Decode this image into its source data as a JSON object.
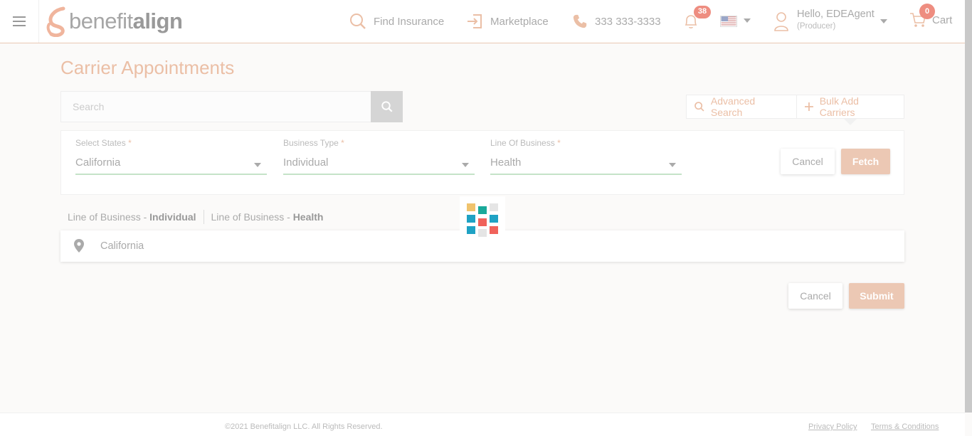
{
  "header": {
    "logo": {
      "part1": "benefit",
      "part2": "align"
    },
    "nav": {
      "find_insurance": "Find Insurance",
      "marketplace": "Marketplace",
      "phone": "333 333-3333"
    },
    "notifications_count": "38",
    "user": {
      "greeting": "Hello, EDEAgent",
      "role": "(Producer)"
    },
    "cart": {
      "label": "Cart",
      "count": "0"
    }
  },
  "page": {
    "title": "Carrier Appointments",
    "search": {
      "placeholder": "Search",
      "value": ""
    },
    "advanced_search": "Advanced Search",
    "bulk_add": "Bulk Add Carriers"
  },
  "filters": {
    "states": {
      "label": "Select States",
      "required": "*",
      "value": "California"
    },
    "business_type": {
      "label": "Business Type",
      "required": "*",
      "value": "Individual"
    },
    "line_of_business": {
      "label": "Line Of Business",
      "required": "*",
      "value": "Health"
    },
    "cancel": "Cancel",
    "fetch": "Fetch"
  },
  "summary": {
    "lob_prefix": "Line of Business - ",
    "business_type_value": "Individual",
    "lob_value": "Health",
    "state": "California"
  },
  "actions": {
    "cancel": "Cancel",
    "submit": "Submit"
  },
  "footer": {
    "copyright": "©2021 Benefitalign LLC. All Rights Reserved.",
    "privacy": "Privacy Policy",
    "terms": "Terms & Conditions"
  },
  "colors": {
    "accent": "#ebbfa6",
    "badge": "#ee8d80",
    "underline": "#c5e3c8"
  },
  "loader_colors": [
    "#f0c36d",
    "#1aa99a",
    "#e5e5e5",
    "#1fa2c4",
    "#f0625b",
    "#1fa2c4",
    "#1fa2c4",
    "#e5e5e5",
    "#f0625b"
  ]
}
